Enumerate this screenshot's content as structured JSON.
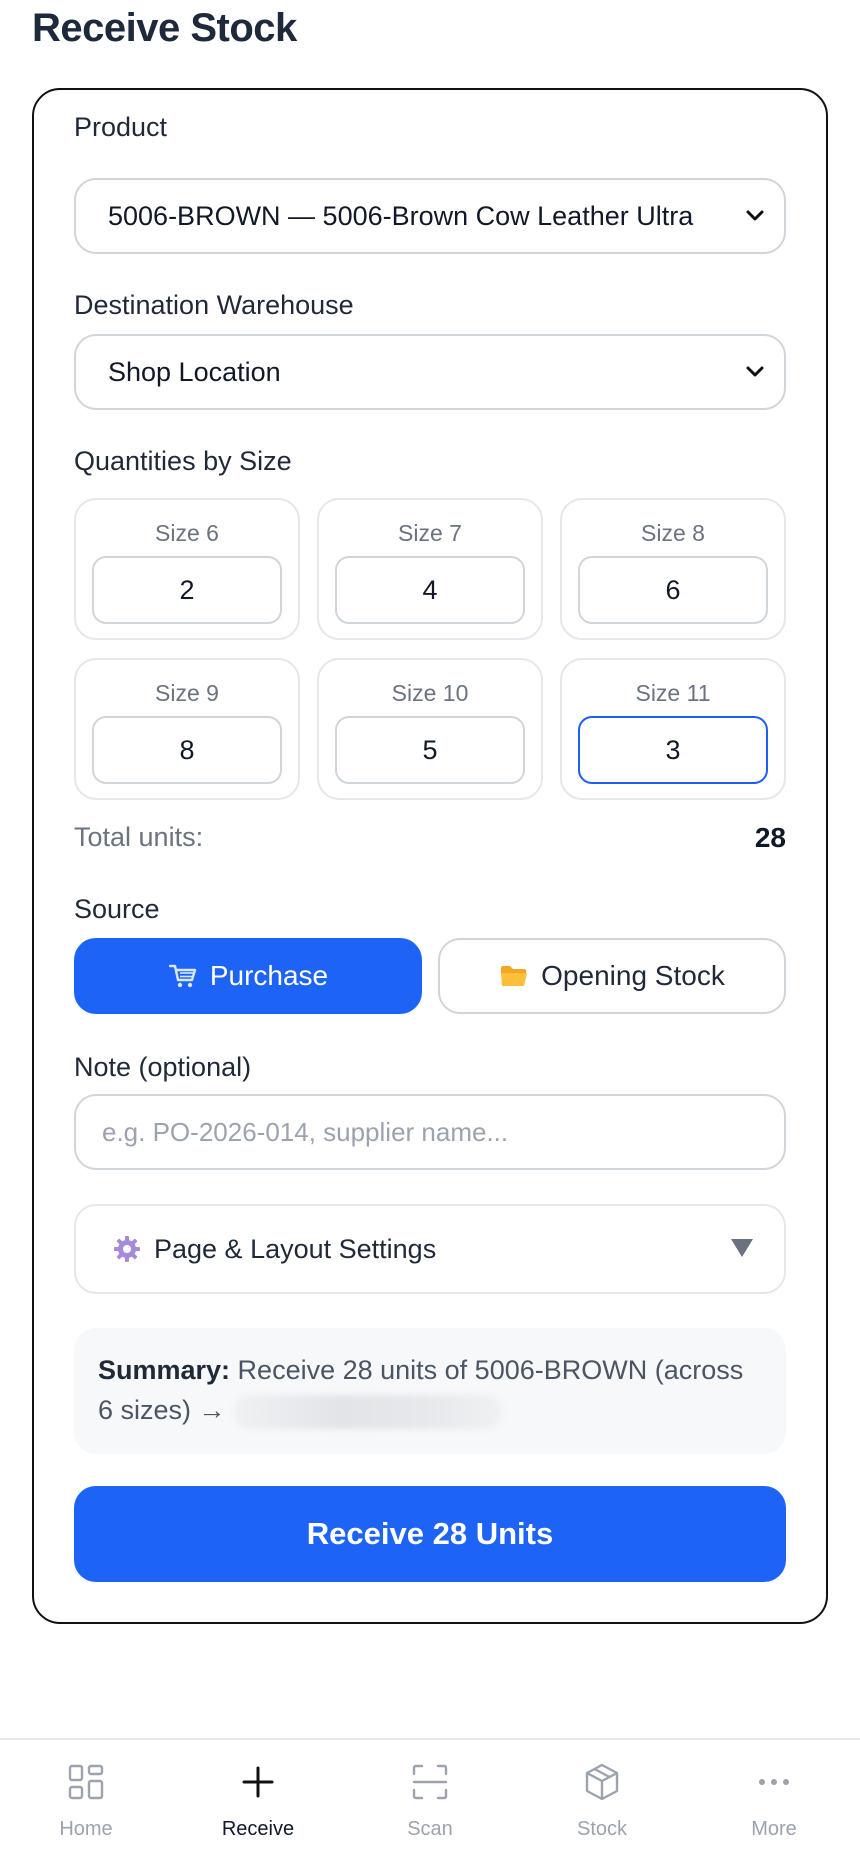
{
  "page": {
    "title": "Receive Stock"
  },
  "form": {
    "product_label": "Product",
    "product_value": "5006-BROWN — 5006-Brown Cow Leather Ultra",
    "warehouse_label": "Destination Warehouse",
    "warehouse_value": "Shop Location",
    "quantities_label": "Quantities by Size",
    "sizes": [
      {
        "label": "Size 6",
        "qty": "2"
      },
      {
        "label": "Size 7",
        "qty": "4"
      },
      {
        "label": "Size 8",
        "qty": "6"
      },
      {
        "label": "Size 9",
        "qty": "8"
      },
      {
        "label": "Size 10",
        "qty": "5"
      },
      {
        "label": "Size 11",
        "qty": "3"
      }
    ],
    "total_label": "Total units:",
    "total_value": "28",
    "source_label": "Source",
    "source_options": [
      {
        "label": "Purchase",
        "icon": "cart-icon",
        "selected": true
      },
      {
        "label": "Opening Stock",
        "icon": "folder-icon",
        "selected": false
      }
    ],
    "note_label": "Note (optional)",
    "note_placeholder": "e.g. PO-2026-014, supplier name...",
    "note_value": "",
    "settings_label": "Page & Layout Settings",
    "settings_icon": "gear-icon",
    "summary_bold": "Summary:",
    "summary_text": " Receive 28 units of 5006-BROWN (across 6 sizes) → ",
    "submit_label": "Receive 28 Units"
  },
  "nav": {
    "items": [
      {
        "label": "Home",
        "icon": "grid-icon",
        "active": false
      },
      {
        "label": "Receive",
        "icon": "plus-icon",
        "active": true
      },
      {
        "label": "Scan",
        "icon": "scan-icon",
        "active": false
      },
      {
        "label": "Stock",
        "icon": "box-icon",
        "active": false
      },
      {
        "label": "More",
        "icon": "more-icon",
        "active": false
      }
    ]
  },
  "colors": {
    "accent": "#1d63f5",
    "focus": "#1d5ef5",
    "muted": "#9ca3af"
  }
}
